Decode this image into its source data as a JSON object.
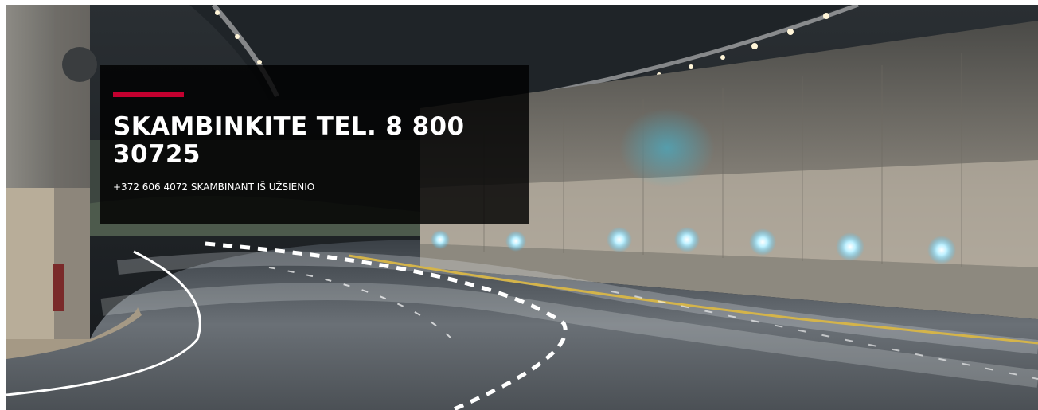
{
  "hero": {
    "image_subject": "illuminated-highway-tunnel",
    "headline": "SKAMBINKITE TEL. 8 800 30725",
    "subline": "+372 606 4072 SKAMBINANT IŠ UŽSIENIO"
  },
  "colors": {
    "accent": "#c3002f",
    "card_background": "#000000",
    "text": "#ffffff"
  }
}
